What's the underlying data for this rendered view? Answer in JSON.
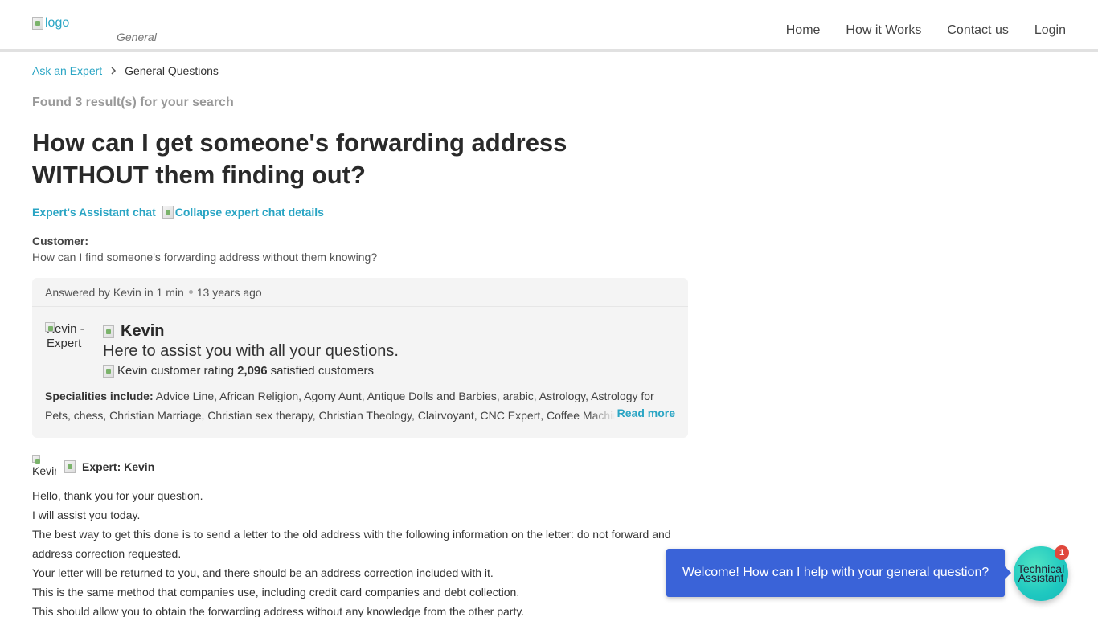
{
  "header": {
    "logo_alt": "logo",
    "category": "General",
    "nav": [
      "Home",
      "How it Works",
      "Contact us",
      "Login"
    ]
  },
  "breadcrumb": {
    "link": "Ask an Expert",
    "current": "General Questions"
  },
  "search": {
    "found_text": "Found 3 result(s) for your search"
  },
  "question": {
    "title": "How can I get someone's forwarding address WITHOUT them finding out?",
    "chat_link": "Expert's Assistant chat",
    "collapse_link": "Collapse expert chat details",
    "customer_label": "Customer:",
    "customer_text": "How can I find someone's forwarding address without them knowing?"
  },
  "answer_card": {
    "answered_by": "Answered by Kevin in 1 min",
    "age": "13 years ago",
    "avatar_alt": "Kevin - Expert",
    "expert_name": "Kevin",
    "tagline": "Here to assist you with all your questions.",
    "rating_alt": "Kevin customer rating",
    "satisfied_count": "2,096",
    "satisfied_label": "satisfied customers",
    "specialities_label": "Specialities include:",
    "specialities": "Advice Line, African Religion, Agony Aunt, Antique Dolls and Barbies, arabic, Astrology, Astrology for Pets, chess, Christian Marriage, Christian sex therapy, Christian Theology, Clairvoyant, CNC Expert, Coffee Machines",
    "read_more": "Read more"
  },
  "expert_answer": {
    "avatar_alt": "Kevin",
    "label": "Expert: Kevin",
    "lines": [
      "Hello, thank you for your question.",
      "I will assist you today.",
      "The best way to get this done is to send a letter to the old address with the following information on the letter: do not forward and address correction requested.",
      "Your letter will be returned to you, and there should be an address correction included with it.",
      "This is the same method that companies use, including credit card companies and debt collection.",
      "This should allow you to obtain the forwarding address without any knowledge from the other party."
    ]
  },
  "chat_widget": {
    "message": "Welcome! How can I help with your general question?",
    "assistant_line1": "Technical",
    "assistant_line2": "Assistant",
    "badge": "1"
  }
}
